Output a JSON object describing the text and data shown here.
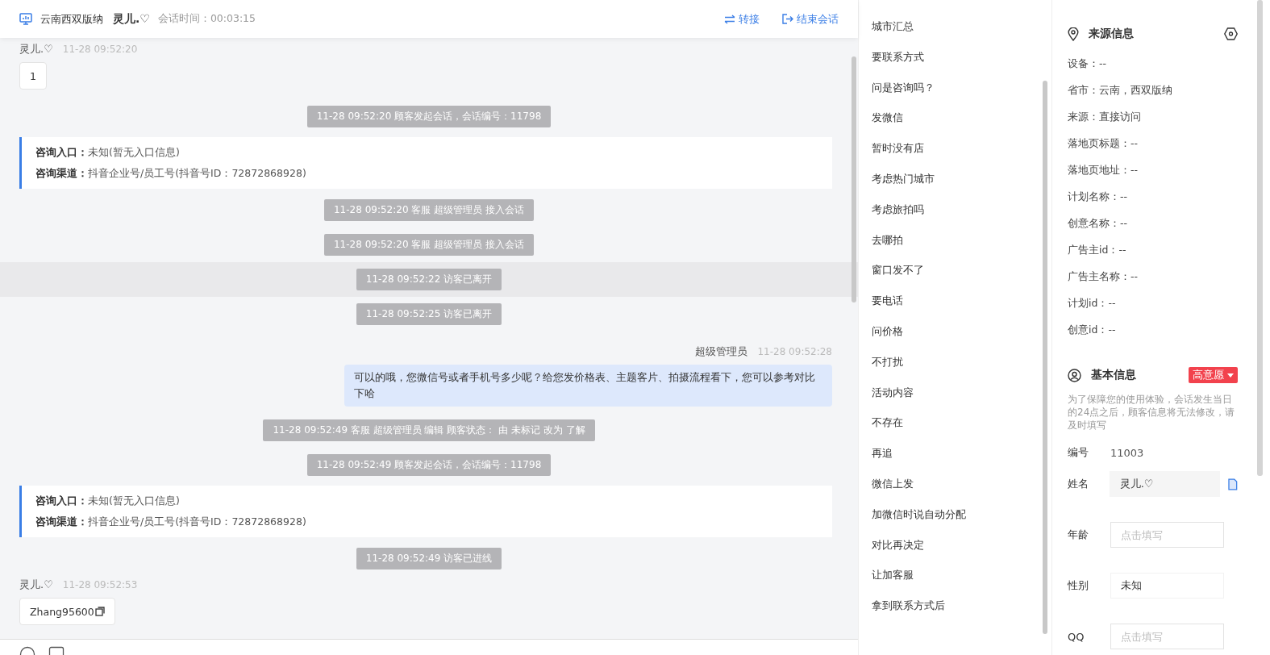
{
  "header": {
    "location": "云南西双版纳",
    "visitor": "灵儿.♡",
    "duration_label": "会话时间：",
    "duration": "00:03:15",
    "actions": [
      {
        "kind": "transfer",
        "label": "转接"
      },
      {
        "kind": "end",
        "label": "结束会话"
      }
    ]
  },
  "messages": [
    {
      "kind": "visitor",
      "name": "灵儿.♡",
      "time": "11-28 09:52:20",
      "text": "1",
      "copy": false
    },
    {
      "kind": "system",
      "text": "11-28 09:52:20 顾客发起会话，会话编号：11798",
      "highlighted": false
    },
    {
      "kind": "entry",
      "lines": [
        "**咨询入口：**未知(暂无入口信息)",
        "**咨询渠道：**抖音企业号/员工号(抖音号ID：72872868928)"
      ]
    },
    {
      "kind": "system",
      "text": "11-28 09:52:20 客服 超级管理员 接入会话",
      "highlighted": false
    },
    {
      "kind": "system",
      "text": "11-28 09:52:20 客服 超级管理员 接入会话",
      "highlighted": false
    },
    {
      "kind": "system",
      "text": "11-28 09:52:22 访客已离开",
      "highlighted": true
    },
    {
      "kind": "system",
      "text": "11-28 09:52:25 访客已离开",
      "highlighted": false
    },
    {
      "kind": "agent",
      "name": "超级管理员",
      "time": "11-28 09:52:28",
      "text": "可以的哦，您微信号或者手机号多少呢？给您发价格表、主题客片、拍摄流程看下，您可以参考对比下哈"
    },
    {
      "kind": "system",
      "text": "11-28 09:52:49 客服 超级管理员 编辑 顾客状态： 由 未标记 改为 了解",
      "highlighted": false
    },
    {
      "kind": "system",
      "text": "11-28 09:52:49 顾客发起会话，会话编号：11798",
      "highlighted": false
    },
    {
      "kind": "entry",
      "lines": [
        "**咨询入口：**未知(暂无入口信息)",
        "**咨询渠道：**抖音企业号/员工号(抖音号ID：72872868928)"
      ]
    },
    {
      "kind": "system",
      "text": "11-28 09:52:49 访客已进线",
      "highlighted": false
    },
    {
      "kind": "visitor",
      "name": "灵儿.♡",
      "time": "11-28 09:52:53",
      "text": "Zhang95600",
      "copy": true
    }
  ],
  "quick_replies": [
    "城市汇总",
    "要联系方式",
    "问是咨询吗？",
    "发微信",
    "暂时没有店",
    "考虑热门城市",
    "考虑旅拍吗",
    "去哪拍",
    "窗口发不了",
    "要电话",
    "问价格",
    "不打扰",
    "活动内容",
    "不存在",
    "再追",
    "微信上发",
    "加微信时说自动分配",
    "对比再决定",
    "让加客服",
    "拿到联系方式后"
  ],
  "source_info": {
    "title": "来源信息",
    "fields": [
      "设备：--",
      "省市：云南，西双版纳",
      "来源：直接访问",
      "落地页标题：--",
      "落地页地址：--",
      "计划名称：--",
      "创意名称：--",
      "广告主id：--",
      "广告主名称：--",
      "计划id：--",
      "创意id：--"
    ]
  },
  "basic_info": {
    "title": "基本信息",
    "intent_tag": "高意愿",
    "notice": "为了保障您的使用体验，会话发生当日的24点之后，顾客信息将无法修改，请及时填写",
    "fields": [
      {
        "kind": "text",
        "label": "编号",
        "value": "11003"
      },
      {
        "kind": "readonly",
        "label": "姓名",
        "value": "灵儿.♡"
      },
      {
        "kind": "input",
        "label": "年龄",
        "placeholder": "点击填写"
      },
      {
        "kind": "select",
        "label": "性别",
        "value": "未知"
      },
      {
        "kind": "input",
        "label": "QQ",
        "placeholder": "点击填写"
      }
    ]
  }
}
